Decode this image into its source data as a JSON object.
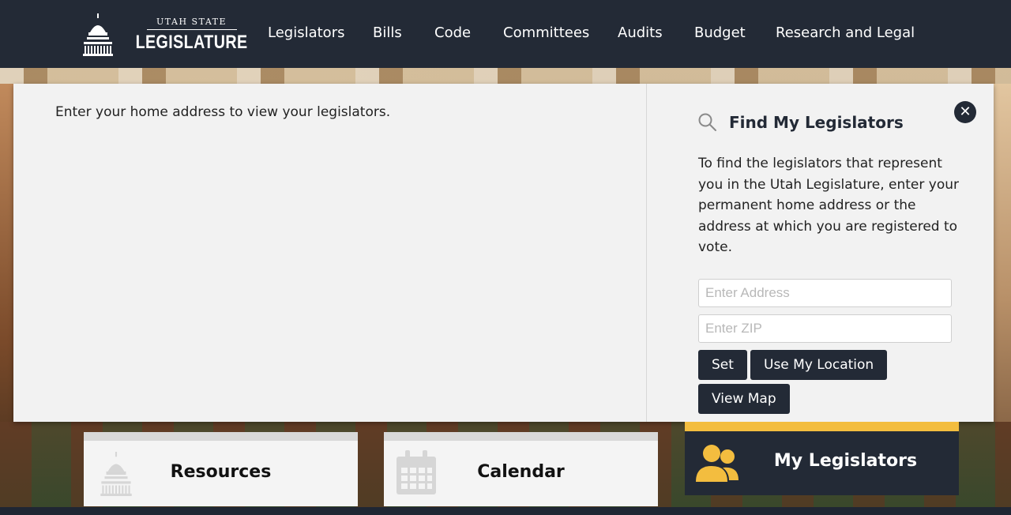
{
  "header": {
    "logo_top": "UTAH STATE",
    "logo_main": "LEGISLATURE",
    "nav": [
      "Legislators",
      "Bills",
      "Code",
      "Committees",
      "Audits",
      "Budget",
      "Research and Legal"
    ]
  },
  "panel": {
    "instruction": "Enter your home address to view your legislators.",
    "find_title": "Find My Legislators",
    "close_label": "✕",
    "description": "To find the legislators that represent you in the Utah Legislature, enter your permanent home address or the address at which you are registered to vote.",
    "address_placeholder": "Enter Address",
    "zip_placeholder": "Enter ZIP",
    "set_label": "Set",
    "location_label": "Use My Location",
    "map_label": "View Map"
  },
  "tiles": {
    "resources": "Resources",
    "calendar": "Calendar",
    "my_legislators": "My Legislators"
  },
  "colors": {
    "header_bg": "#232a36",
    "accent": "#f3bd3f",
    "panel_bg": "#f2f2f2"
  }
}
